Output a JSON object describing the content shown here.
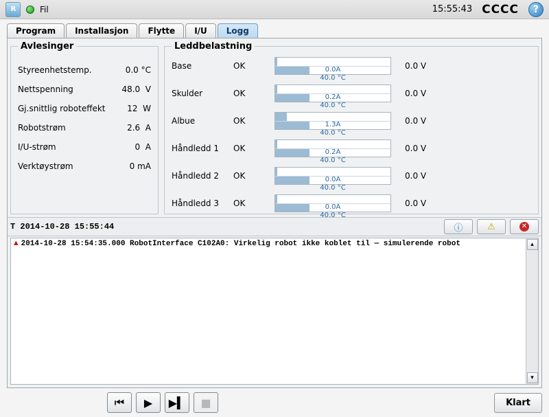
{
  "top": {
    "file_menu": "Fil",
    "clock": "15:55:43",
    "cccc": "CCCC"
  },
  "tabs": [
    "Program",
    "Installasjon",
    "Flytte",
    "I/U",
    "Logg"
  ],
  "active_tab": 4,
  "readings": {
    "legend": "Avlesinger",
    "rows": [
      {
        "label": "Styreenhetstemp.",
        "value": "0.0 °C"
      },
      {
        "label": "Nettspenning",
        "value": "48.0  V"
      },
      {
        "label": "Gj.snittlig roboteffekt",
        "value": "12  W"
      },
      {
        "label": "Robotstrøm",
        "value": "2.6  A"
      },
      {
        "label": "I/U-strøm",
        "value": "0  A"
      },
      {
        "label": "Verktøystrøm",
        "value": "0 mA"
      }
    ]
  },
  "joints": {
    "legend": "Leddbelastning",
    "rows": [
      {
        "name": "Base",
        "status": "OK",
        "amp": "0.0A",
        "amp_pct": 2,
        "temp": "40.0 °C",
        "temp_pct": 30,
        "volt": "0.0 V"
      },
      {
        "name": "Skulder",
        "status": "OK",
        "amp": "0.2A",
        "amp_pct": 2,
        "temp": "40.0 °C",
        "temp_pct": 30,
        "volt": "0.0 V"
      },
      {
        "name": "Albue",
        "status": "OK",
        "amp": "1.3A",
        "amp_pct": 10,
        "temp": "40.0 °C",
        "temp_pct": 30,
        "volt": "0.0 V"
      },
      {
        "name": "Håndledd 1",
        "status": "OK",
        "amp": "0.2A",
        "amp_pct": 2,
        "temp": "40.0 °C",
        "temp_pct": 30,
        "volt": "0.0 V"
      },
      {
        "name": "Håndledd 2",
        "status": "OK",
        "amp": "0.0A",
        "amp_pct": 2,
        "temp": "40.0 °C",
        "temp_pct": 30,
        "volt": "0.0 V"
      },
      {
        "name": "Håndledd 3",
        "status": "OK",
        "amp": "0.0A",
        "amp_pct": 2,
        "temp": "40.0 °C",
        "temp_pct": 30,
        "volt": "0.0 V"
      }
    ]
  },
  "mid": {
    "timestamp": "T 2014-10-28 15:55:44"
  },
  "log": {
    "lines": [
      {
        "severity": "error",
        "text": "2014-10-28 15:54:35.000 RobotInterface C102A0: Virkelig robot ikke koblet til — simulerende robot"
      }
    ]
  },
  "bottom": {
    "done": "Klart"
  }
}
